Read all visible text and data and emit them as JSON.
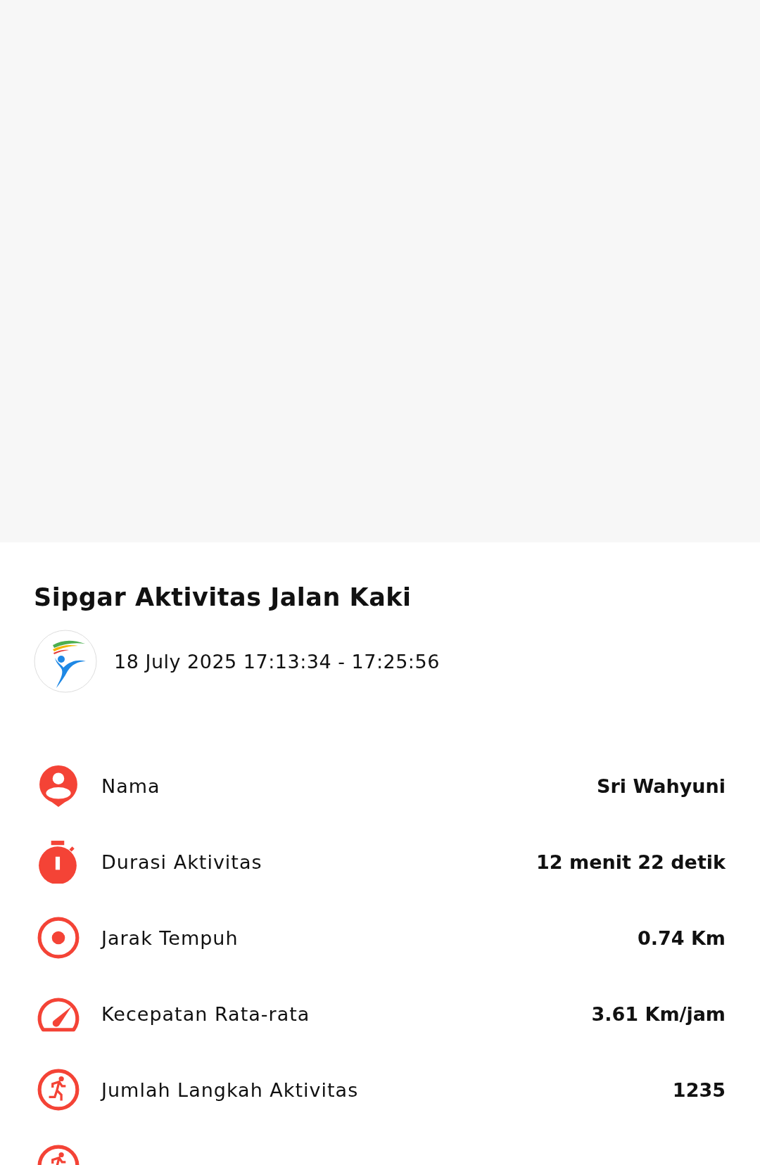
{
  "title": "Sipgar Aktivitas Jalan Kaki",
  "datetime": "18 July 2025 17:13:34 - 17:25:56",
  "stats": [
    {
      "kind": "person",
      "label": "Nama",
      "value": "Sri Wahyuni"
    },
    {
      "kind": "timer",
      "label": "Durasi Aktivitas",
      "value": "12 menit 22 detik"
    },
    {
      "kind": "target",
      "label": "Jarak Tempuh",
      "value": "0.74 Km"
    },
    {
      "kind": "speed",
      "label": "Kecepatan Rata-rata",
      "value": "3.61 Km/jam"
    },
    {
      "kind": "walk",
      "label": "Jumlah Langkah Aktivitas",
      "value": "1235"
    },
    {
      "kind": "walk"
    }
  ]
}
